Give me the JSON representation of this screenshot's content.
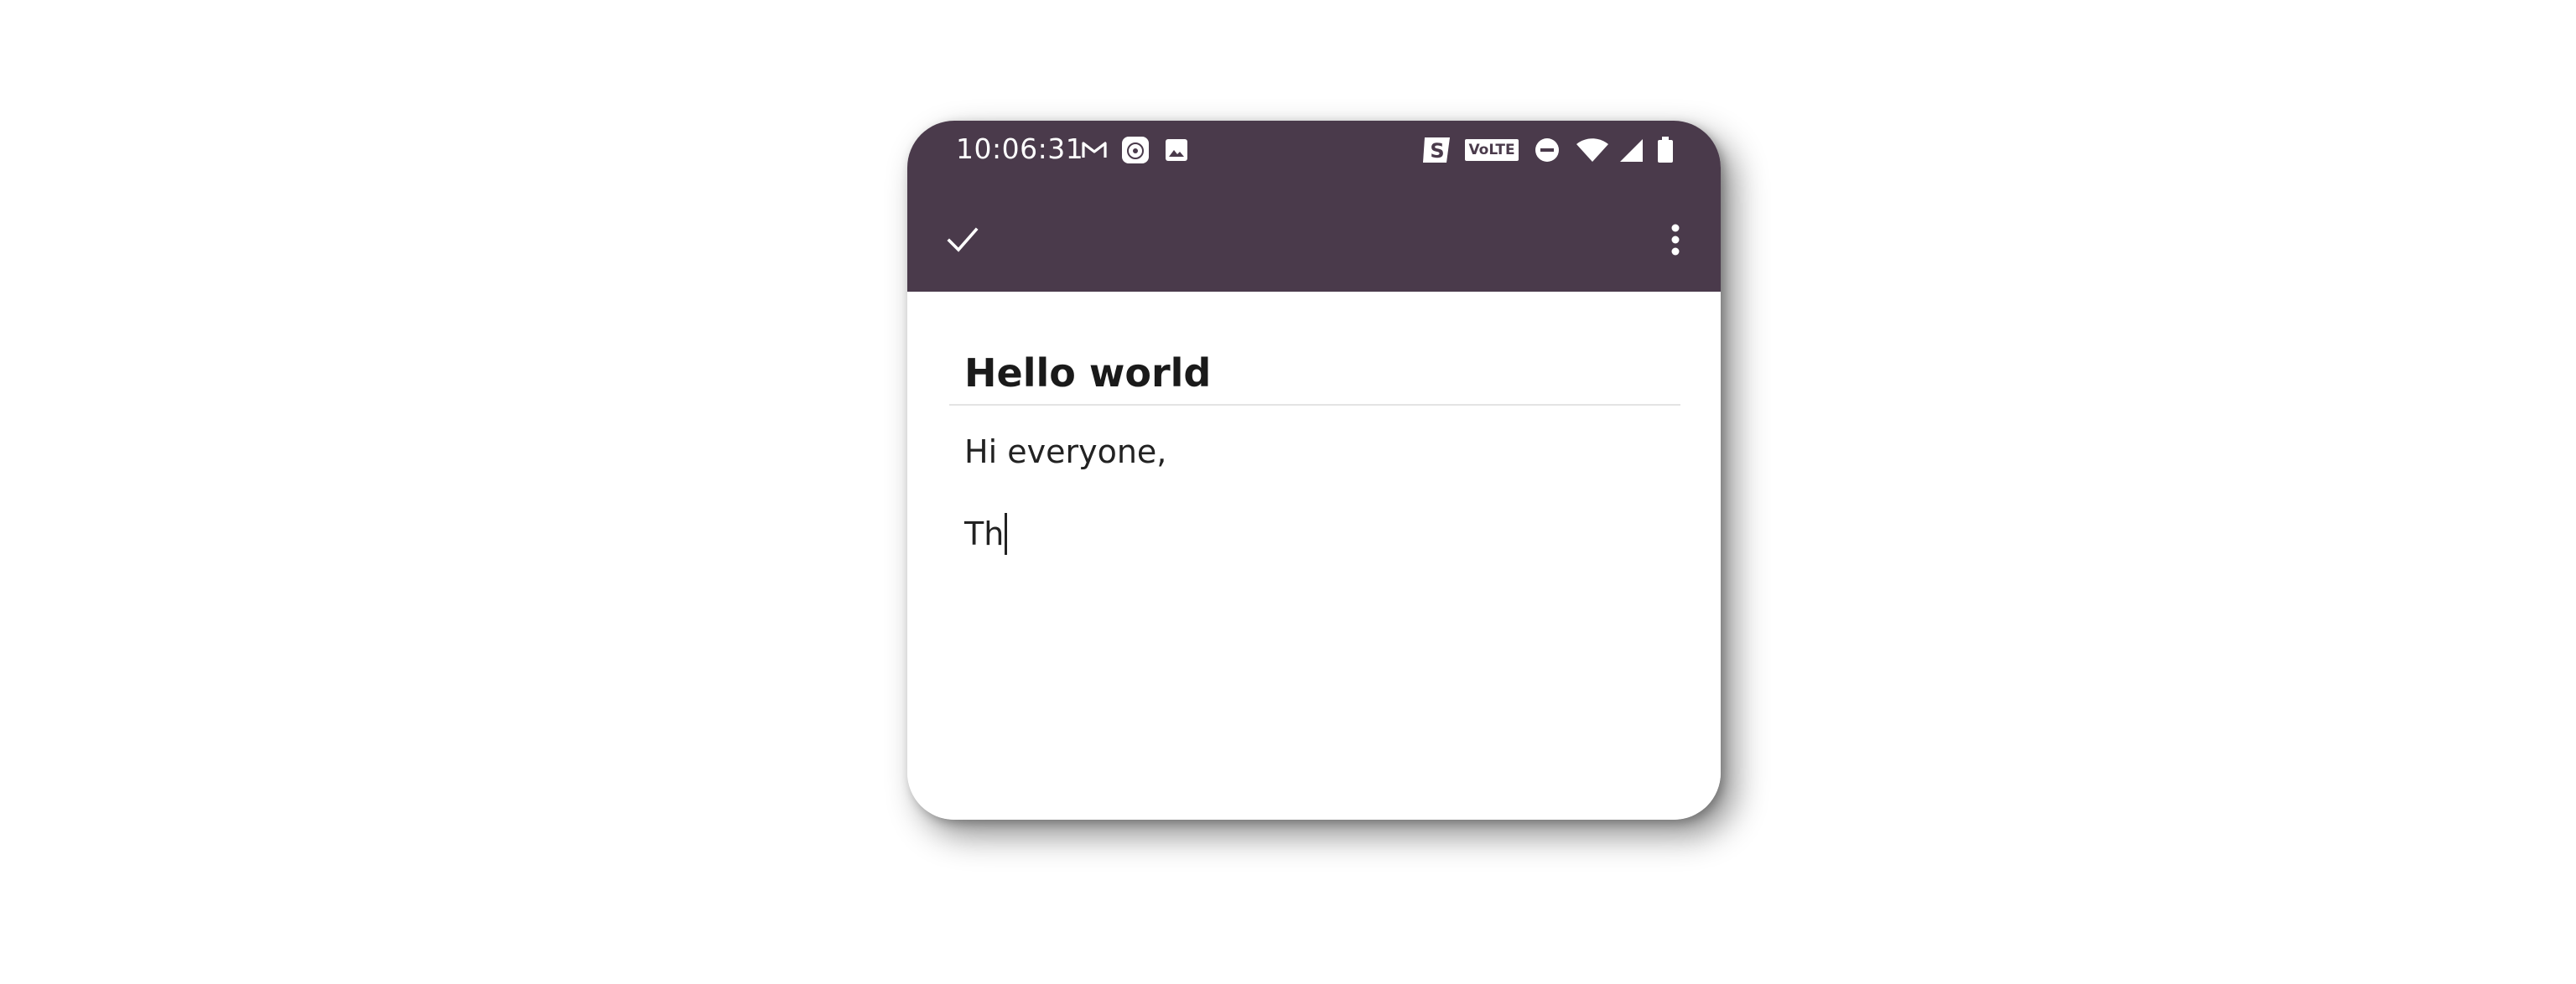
{
  "status_bar": {
    "time": "10:06:31",
    "left_icons": [
      "gmail-icon",
      "camera-app-icon",
      "image-icon"
    ],
    "right_icons": [
      "s-app-icon",
      "volte-icon",
      "do-not-disturb-icon",
      "wifi-icon",
      "cell-signal-icon",
      "battery-icon"
    ],
    "volte_label": "VoLTE",
    "background": "#4a3a4b"
  },
  "toolbar": {
    "confirm_icon": "check-icon",
    "overflow_icon": "more-vert-icon",
    "background": "#4a3a4b"
  },
  "note": {
    "title": "Hello world",
    "body_lines": [
      "Hi everyone,",
      "Th"
    ]
  }
}
